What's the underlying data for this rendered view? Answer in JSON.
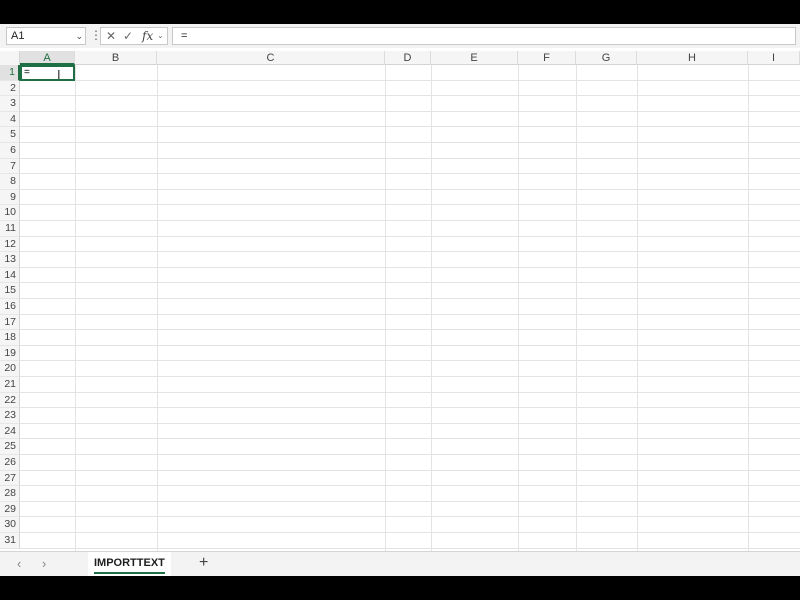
{
  "formula_bar": {
    "name_box": "A1",
    "name_box_arrow": "⌄",
    "dots": "⋮",
    "cancel_icon": "✕",
    "enter_icon": "✓",
    "fx_label": "fx",
    "fx_arrow": "⌄",
    "formula": "="
  },
  "columns": [
    "A",
    "B",
    "C",
    "D",
    "E",
    "F",
    "G",
    "H",
    "I"
  ],
  "rows": [
    "1",
    "2",
    "3",
    "4",
    "5",
    "6",
    "7",
    "8",
    "9",
    "10",
    "11",
    "12",
    "13",
    "14",
    "15",
    "16",
    "17",
    "18",
    "19",
    "20",
    "21",
    "22",
    "23",
    "24",
    "25",
    "26",
    "27",
    "28",
    "29",
    "30",
    "31"
  ],
  "active_cell": {
    "ref": "A1",
    "value": "=",
    "cursor": "I"
  },
  "sheet_bar": {
    "prev": "‹",
    "next": "›",
    "tab": "IMPORTTEXT",
    "add": "+"
  },
  "colors": {
    "accent": "#1e6f43"
  }
}
